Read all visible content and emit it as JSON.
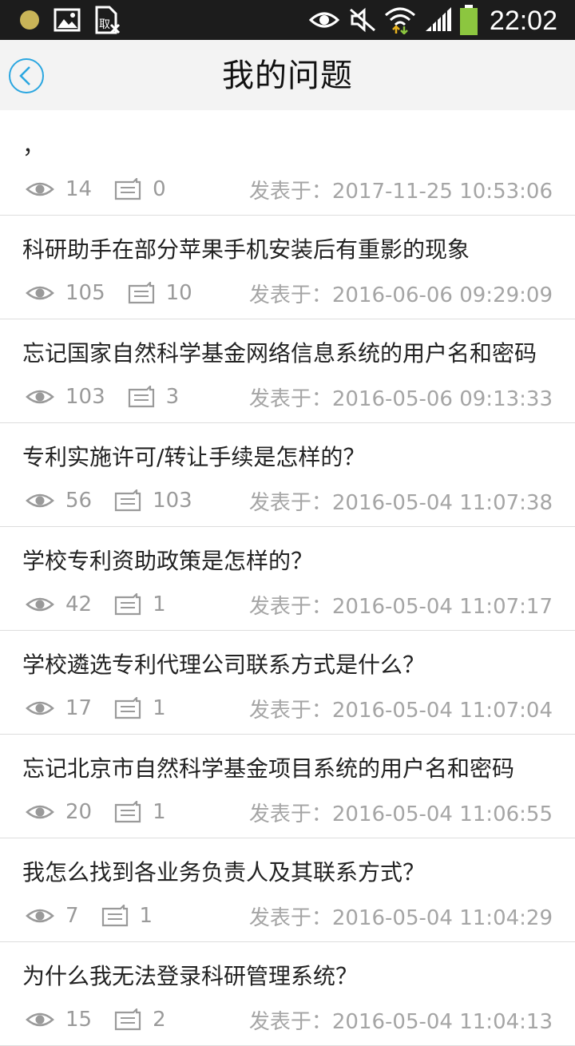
{
  "status_bar": {
    "time": "22:02",
    "icons": [
      "notification-dot-icon",
      "image-icon",
      "sim-card-icon",
      "eye-icon",
      "mute-icon",
      "wifi-icon",
      "signal-icon",
      "battery-icon"
    ]
  },
  "header": {
    "title": "我的问题",
    "back_icon": "chevron-left-icon"
  },
  "list": {
    "date_prefix": "发表于：",
    "items": [
      {
        "title": "，",
        "views": "14",
        "replies": "0",
        "date": "发表于：2017-11-25 10:53:06"
      },
      {
        "title": "科研助手在部分苹果手机安装后有重影的现象",
        "views": "105",
        "replies": "10",
        "date": "发表于：2016-06-06 09:29:09"
      },
      {
        "title": "忘记国家自然科学基金网络信息系统的用户名和密码",
        "views": "103",
        "replies": "3",
        "date": "发表于：2016-05-06 09:13:33"
      },
      {
        "title": "专利实施许可/转让手续是怎样的？",
        "views": "56",
        "replies": "103",
        "date": "发表于：2016-05-04 11:07:38"
      },
      {
        "title": "学校专利资助政策是怎样的？",
        "views": "42",
        "replies": "1",
        "date": "发表于：2016-05-04 11:07:17"
      },
      {
        "title": "学校遴选专利代理公司联系方式是什么？",
        "views": "17",
        "replies": "1",
        "date": "发表于：2016-05-04 11:07:04"
      },
      {
        "title": "忘记北京市自然科学基金项目系统的用户名和密码",
        "views": "20",
        "replies": "1",
        "date": "发表于：2016-05-04 11:06:55"
      },
      {
        "title": "我怎么找到各业务负责人及其联系方式？",
        "views": "7",
        "replies": "1",
        "date": "发表于：2016-05-04 11:04:29"
      },
      {
        "title": "为什么我无法登录科研管理系统？",
        "views": "15",
        "replies": "2",
        "date": "发表于：2016-05-04 11:04:13"
      }
    ]
  },
  "colors": {
    "status_bar_bg": "#1c1c1c",
    "nav_bg": "#f3f3f3",
    "accent": "#2aa6e0",
    "meta_text": "#9a9a9a",
    "battery": "#8cc63f"
  }
}
